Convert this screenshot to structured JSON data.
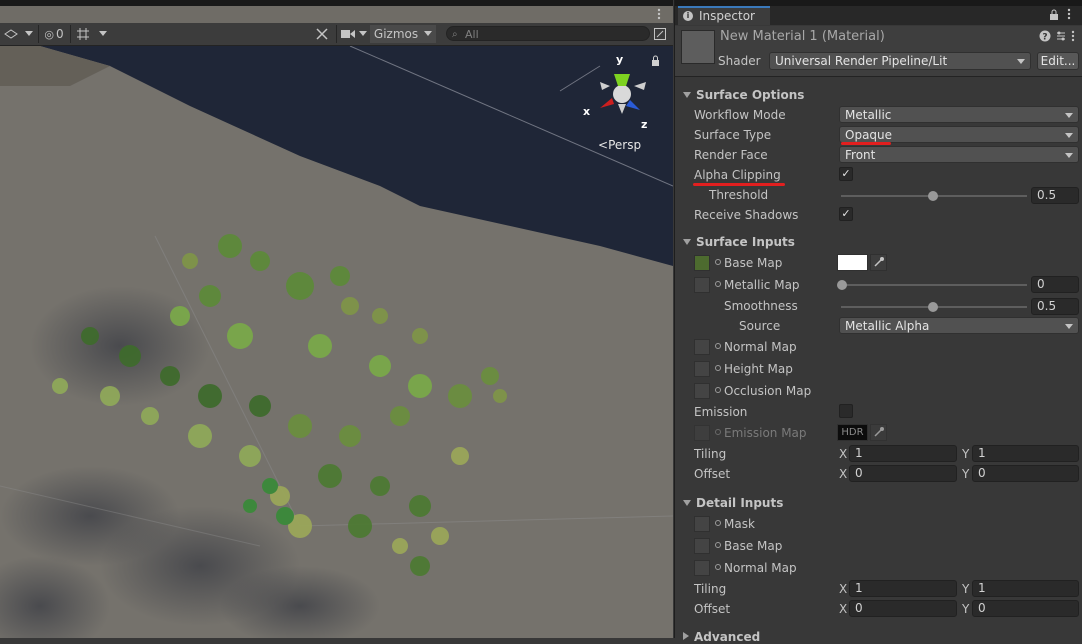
{
  "scene": {
    "toolbar": {
      "hidden_count": "0",
      "gizmos_label": "Gizmos",
      "search_placeholder": "All"
    },
    "view_mode": "Persp",
    "axes": {
      "x": "x",
      "y": "y",
      "z": "z"
    }
  },
  "inspector": {
    "tab_label": "Inspector",
    "material_title": "New Material 1 (Material)",
    "shader_label": "Shader",
    "shader_value": "Universal Render Pipeline/Lit",
    "edit_label": "Edit...",
    "surface_options": {
      "title": "Surface Options",
      "workflow_mode_label": "Workflow Mode",
      "workflow_mode_value": "Metallic",
      "surface_type_label": "Surface Type",
      "surface_type_value": "Opaque",
      "render_face_label": "Render Face",
      "render_face_value": "Front",
      "alpha_clipping_label": "Alpha Clipping",
      "alpha_clipping_checked": true,
      "threshold_label": "Threshold",
      "threshold_value": "0.5",
      "receive_shadows_label": "Receive Shadows",
      "receive_shadows_checked": true
    },
    "surface_inputs": {
      "title": "Surface Inputs",
      "base_map_label": "Base Map",
      "metallic_map_label": "Metallic Map",
      "metallic_value": "0",
      "smoothness_label": "Smoothness",
      "smoothness_value": "0.5",
      "source_label": "Source",
      "source_value": "Metallic Alpha",
      "normal_map_label": "Normal Map",
      "height_map_label": "Height Map",
      "occlusion_map_label": "Occlusion Map",
      "emission_label": "Emission",
      "emission_map_label": "Emission Map",
      "hdr_label": "HDR",
      "tiling_label": "Tiling",
      "tiling_x": "1",
      "tiling_y": "1",
      "offset_label": "Offset",
      "offset_x": "0",
      "offset_y": "0",
      "x_label": "X",
      "y_label": "Y"
    },
    "detail_inputs": {
      "title": "Detail Inputs",
      "mask_label": "Mask",
      "base_map_label": "Base Map",
      "normal_map_label": "Normal Map",
      "tiling_label": "Tiling",
      "tiling_x": "1",
      "tiling_y": "1",
      "offset_label": "Offset",
      "offset_x": "0",
      "offset_y": "0"
    },
    "advanced_title": "Advanced"
  },
  "colors": {
    "annotation_red": "#e21f1f",
    "tab_accent": "#3a79bb"
  }
}
